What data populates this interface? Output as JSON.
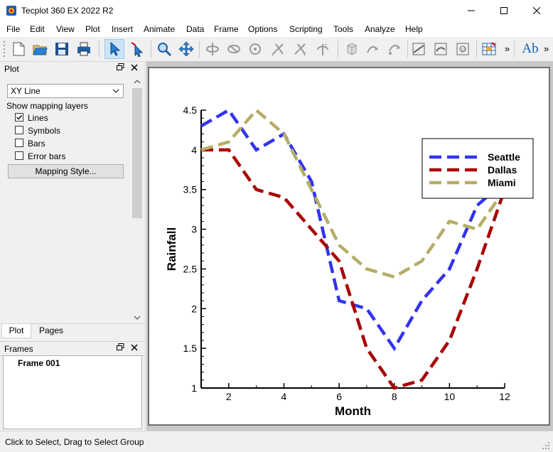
{
  "window": {
    "title": "Tecplot 360 EX 2022 R2"
  },
  "menu": [
    "File",
    "Edit",
    "View",
    "Plot",
    "Insert",
    "Animate",
    "Data",
    "Frame",
    "Options",
    "Scripting",
    "Tools",
    "Analyze",
    "Help"
  ],
  "toolbar": {
    "overflow": "»",
    "text_tool": "Ab"
  },
  "plot_panel": {
    "title": "Plot",
    "plot_type": "XY Line",
    "layers_label": "Show mapping layers",
    "layers": [
      {
        "label": "Lines",
        "checked": true
      },
      {
        "label": "Symbols",
        "checked": false
      },
      {
        "label": "Bars",
        "checked": false
      },
      {
        "label": "Error bars",
        "checked": false
      }
    ],
    "mapping_style_button": "Mapping Style..."
  },
  "tabs": [
    "Plot",
    "Pages"
  ],
  "frames_panel": {
    "title": "Frames",
    "items": [
      "Frame 001"
    ]
  },
  "status": "Click to Select, Drag to Select Group",
  "chart_data": {
    "type": "line",
    "xlabel": "Month",
    "ylabel": "Rainfall",
    "xlim": [
      1,
      12
    ],
    "ylim": [
      1,
      4.5
    ],
    "xticks": [
      "2",
      "4",
      "6",
      "8",
      "10",
      "12"
    ],
    "yticks": [
      "1",
      "1.5",
      "2",
      "2.5",
      "3",
      "3.5",
      "4",
      "4.5"
    ],
    "legend_position": "upper-right",
    "grid": false,
    "x": [
      1,
      2,
      3,
      4,
      5,
      6,
      7,
      8,
      9,
      10,
      11,
      12
    ],
    "series": [
      {
        "name": "Seattle",
        "color": "#3333ee",
        "values": [
          4.3,
          4.5,
          4.0,
          4.2,
          3.6,
          2.1,
          2.0,
          1.5,
          2.1,
          2.5,
          3.3,
          3.6
        ]
      },
      {
        "name": "Dallas",
        "color": "#aa0000",
        "values": [
          4.0,
          4.0,
          3.5,
          3.4,
          3.0,
          2.6,
          1.5,
          1.0,
          1.1,
          1.6,
          2.5,
          3.5
        ]
      },
      {
        "name": "Miami",
        "color": "#b5ad66",
        "values": [
          4.0,
          4.1,
          4.5,
          4.2,
          3.5,
          2.8,
          2.5,
          2.4,
          2.6,
          3.1,
          3.0,
          3.5
        ]
      }
    ]
  }
}
